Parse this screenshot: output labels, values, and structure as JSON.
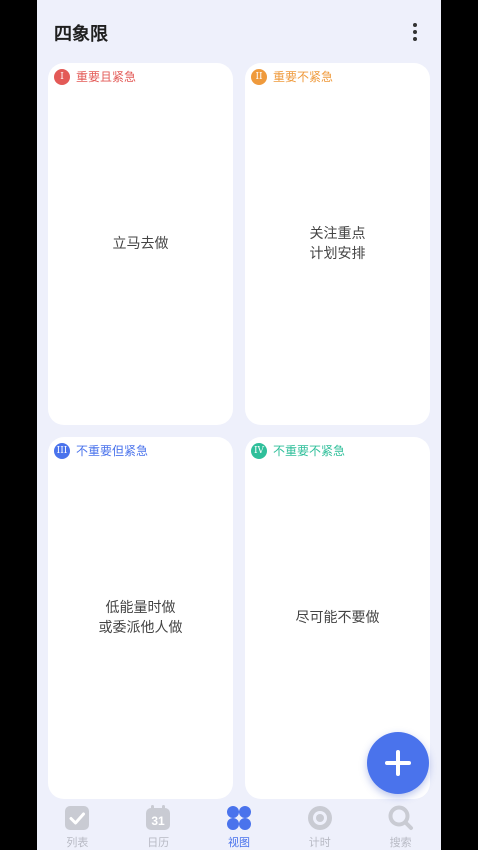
{
  "header": {
    "title": "四象限"
  },
  "quadrants": [
    {
      "badge": "I",
      "label": "重要且紧急",
      "color": "#e35a57",
      "lines": [
        "立马去做"
      ]
    },
    {
      "badge": "II",
      "label": "重要不紧急",
      "color": "#ef9a3c",
      "lines": [
        "关注重点",
        "计划安排"
      ]
    },
    {
      "badge": "III",
      "label": "不重要但紧急",
      "color": "#4a73ec",
      "lines": [
        "低能量时做",
        "或委派他人做"
      ]
    },
    {
      "badge": "IV",
      "label": "不重要不紧急",
      "color": "#2fbf9a",
      "lines": [
        "尽可能不要做"
      ]
    }
  ],
  "calendar_day": "31",
  "nav": [
    {
      "label": "列表",
      "icon": "checkbox-icon",
      "active": false
    },
    {
      "label": "日历",
      "icon": "calendar-icon",
      "active": false
    },
    {
      "label": "视图",
      "icon": "four-dots-icon",
      "active": true
    },
    {
      "label": "计时",
      "icon": "timer-icon",
      "active": false
    },
    {
      "label": "搜索",
      "icon": "search-icon",
      "active": false
    }
  ],
  "colors": {
    "accent": "#4a73ec",
    "nav_inactive": "#b8bac4"
  }
}
